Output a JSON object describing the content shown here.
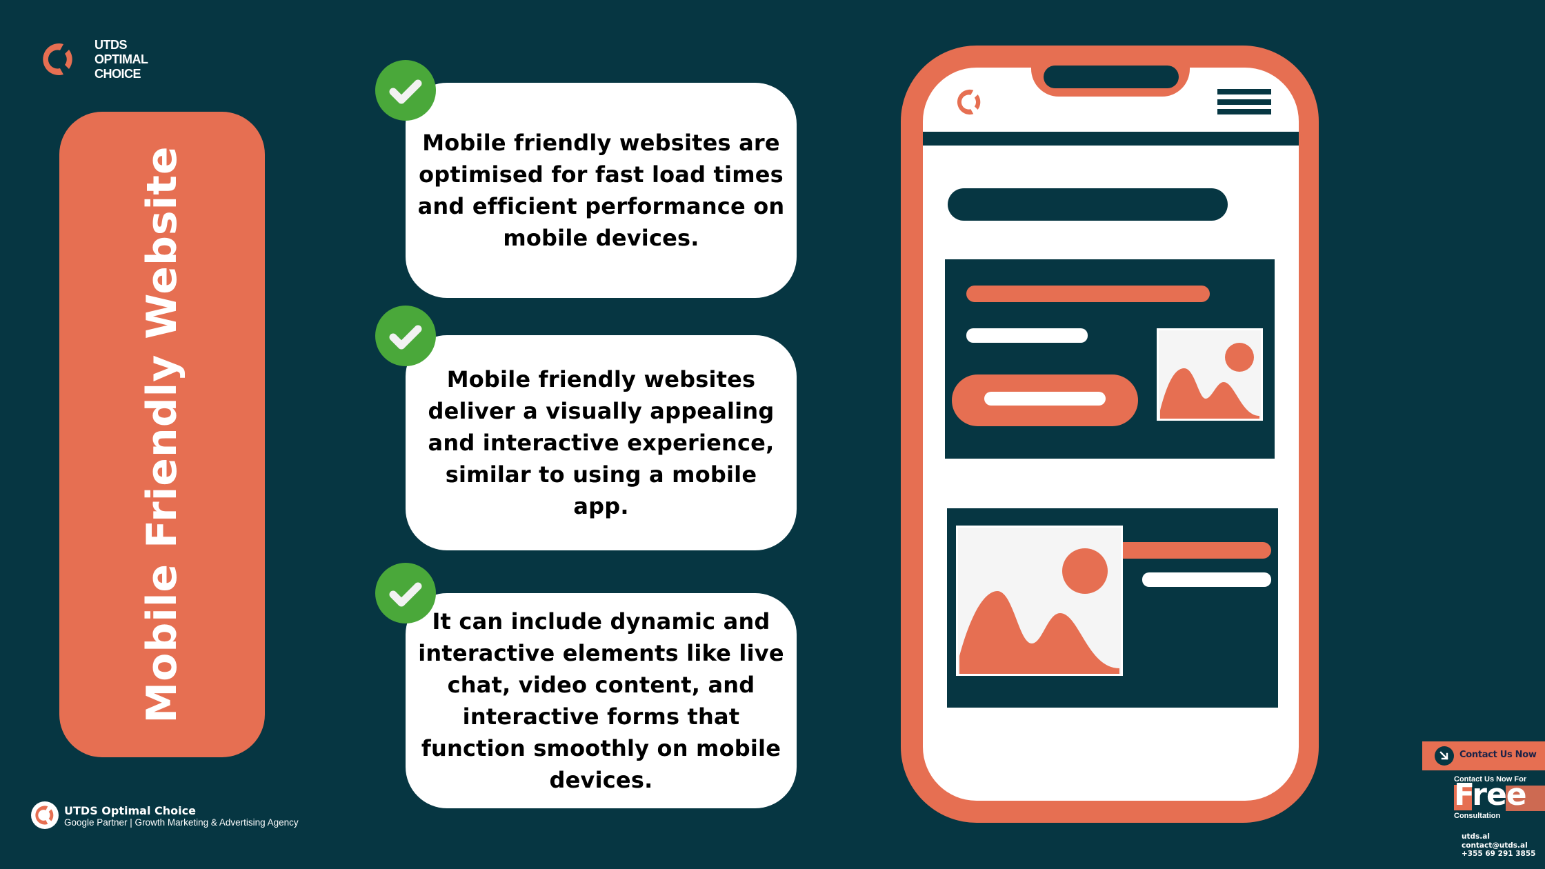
{
  "brand": {
    "logo_icon": "utds-logo-icon",
    "name_lines": [
      "UTDS",
      "OPTIMAL",
      "CHOICE"
    ]
  },
  "banner": {
    "title": "Mobile Friendly Website"
  },
  "features": [
    {
      "icon": "check-icon",
      "text": "Mobile friendly websites are optimised for fast load times and efficient performance on mobile devices."
    },
    {
      "icon": "check-icon",
      "text": "Mobile friendly websites deliver a visually appealing and interactive experience, similar to using a mobile app."
    },
    {
      "icon": "check-icon",
      "text": "It can include dynamic and interactive elements like live chat, video content, and interactive forms that function smoothly on mobile devices."
    }
  ],
  "phone_mockup": {
    "logo_icon": "utds-logo-icon",
    "menu_icon": "hamburger-menu-icon",
    "image_icon": "image-placeholder-icon"
  },
  "footer": {
    "company": "UTDS Optimal Choice",
    "tagline": "Google Partner | Growth Marketing & Advertising Agency"
  },
  "contact": {
    "button_label": "Contact Us Now",
    "button_icon": "arrow-down-right-icon",
    "promo_top": "Contact Us Now For",
    "promo_highlight": "Free",
    "promo_bottom": "Consultation",
    "website": "utds.al",
    "email": "contact@utds.al",
    "phone": "+355 69 291 3855"
  },
  "colors": {
    "background": "#063642",
    "accent": "#e66f52",
    "check_green": "#4aa83a",
    "card": "#ffffff"
  }
}
